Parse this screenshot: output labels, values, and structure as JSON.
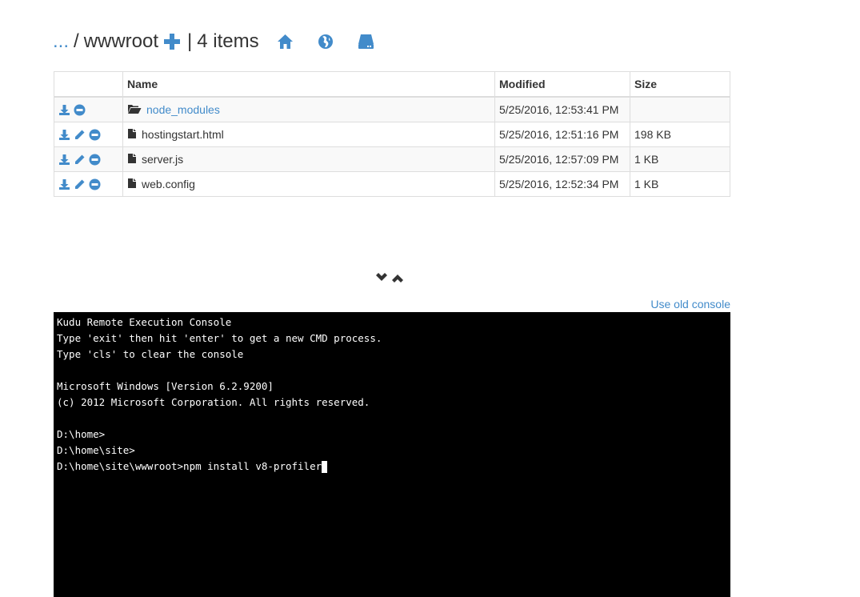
{
  "header": {
    "breadcrumb_parent": "...",
    "breadcrumb_separator": "/",
    "current_folder": "wwwroot",
    "pipe": "|",
    "item_count": "4 items",
    "icons": [
      "plus-icon",
      "home-icon",
      "globe-icon",
      "hdd-icon"
    ]
  },
  "table": {
    "columns": [
      "",
      "Name",
      "Modified",
      "Size"
    ],
    "rows": [
      {
        "type": "folder",
        "name": "node_modules",
        "modified": "5/25/2016, 12:53:41 PM",
        "size": "",
        "actions": [
          "download-icon",
          "remove-icon"
        ]
      },
      {
        "type": "file",
        "name": "hostingstart.html",
        "modified": "5/25/2016, 12:51:16 PM",
        "size": "198 KB",
        "actions": [
          "download-icon",
          "edit-icon",
          "remove-icon"
        ]
      },
      {
        "type": "file",
        "name": "server.js",
        "modified": "5/25/2016, 12:57:09 PM",
        "size": "1 KB",
        "actions": [
          "download-icon",
          "edit-icon",
          "remove-icon"
        ]
      },
      {
        "type": "file",
        "name": "web.config",
        "modified": "5/25/2016, 12:52:34 PM",
        "size": "1 KB",
        "actions": [
          "download-icon",
          "edit-icon",
          "remove-icon"
        ]
      }
    ]
  },
  "console": {
    "old_console_link": "Use old console",
    "lines": [
      "Kudu Remote Execution Console",
      "Type 'exit' then hit 'enter' to get a new CMD process.",
      "Type 'cls' to clear the console",
      "",
      "Microsoft Windows [Version 6.2.9200]",
      "(c) 2012 Microsoft Corporation. All rights reserved.",
      "",
      "D:\\home>",
      "D:\\home\\site>"
    ],
    "prompt": "D:\\home\\site\\wwwroot>",
    "input": "npm install v8-profiler"
  },
  "colors": {
    "accent": "#428bca",
    "icon_blue": "#428bca",
    "console_bg": "#000000",
    "console_fg": "#ffffff"
  }
}
